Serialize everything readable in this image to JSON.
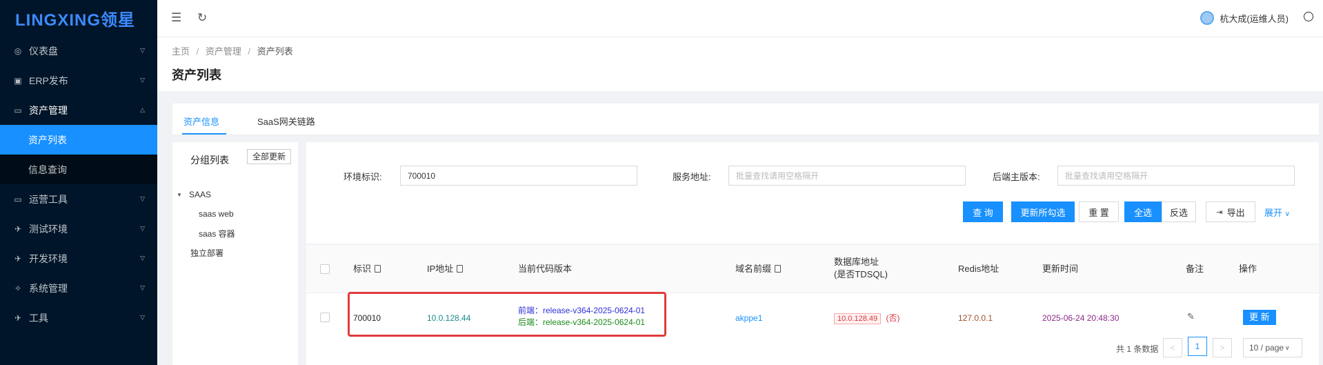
{
  "sidebar": {
    "logo": "LINGXING领星",
    "items": [
      {
        "label": "仪表盘"
      },
      {
        "label": "ERP发布"
      },
      {
        "label": "资产管理"
      },
      {
        "label": "运营工具"
      },
      {
        "label": "测试环境"
      },
      {
        "label": "开发环境"
      },
      {
        "label": "系统管理"
      },
      {
        "label": "工具"
      }
    ],
    "asset_sub": [
      {
        "label": "资产列表"
      },
      {
        "label": "信息查询"
      }
    ]
  },
  "header": {
    "user_name": "杭大成(运维人员)"
  },
  "breadcrumb": {
    "home": "主页",
    "level2": "资产管理",
    "level3": "资产列表",
    "sep": "/"
  },
  "page_title": "资产列表",
  "tabs": [
    {
      "label": "资产信息"
    },
    {
      "label": "SaaS网关链路"
    }
  ],
  "group": {
    "title": "分组列表",
    "update_all": "全部更新",
    "tree": {
      "root": "SAAS",
      "children": [
        "saas web",
        "saas 容器"
      ],
      "other": "独立部署"
    }
  },
  "search": {
    "env_label": "环境标识:",
    "env_value": "700010",
    "service_label": "服务地址:",
    "service_placeholder": "批量查找请用空格隔开",
    "backend_label": "后端主版本:",
    "backend_placeholder": "批量查找请用空格隔开",
    "buttons": {
      "query": "查 询",
      "update_selected": "更新所勾选",
      "reset": "重 置",
      "select_all": "全选",
      "invert": "反选",
      "export": "导出",
      "expand": "展开"
    }
  },
  "table": {
    "headers": {
      "id": "标识",
      "ip": "IP地址",
      "version": "当前代码版本",
      "domain": "域名前缀",
      "db_line1": "数据库地址",
      "db_line2": "(是否TDSQL)",
      "redis": "Redis地址",
      "updated": "更新时间",
      "remark": "备注",
      "action": "操作"
    },
    "rows": [
      {
        "id": "700010",
        "ip": "10.0.128.44",
        "frontend": "前端：release-v364-2025-0624-01",
        "backend": "后端：release-v364-2025-0624-01",
        "domain": "akppe1",
        "db": "10.0.128.49",
        "tdsql": "(否)",
        "redis": "127.0.0.1",
        "updated": "2025-06-24 20:48:30",
        "action": "更 新"
      }
    ]
  },
  "pagination": {
    "total": "共 1 条数据",
    "current": "1",
    "page_size": "10 / page"
  },
  "colors": {
    "primary": "#1890ff",
    "sidebar_bg": "#001529",
    "highlight": "#e03b3b",
    "frontend": "#2f2fd6",
    "backend": "#1a8a1a",
    "time": "#8a2a8a",
    "redis": "#a0522d",
    "ip": "#1a8a8a"
  }
}
